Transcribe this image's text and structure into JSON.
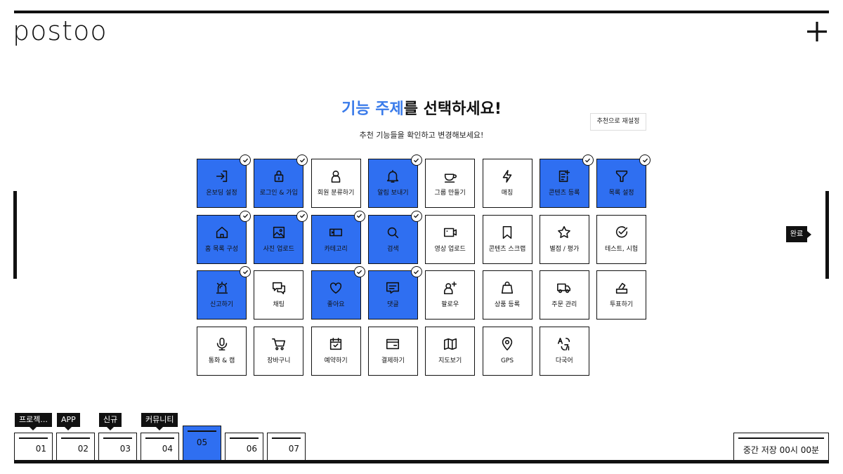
{
  "brand": {
    "logo": "postoo"
  },
  "header": {
    "plus_icon": "plus-icon"
  },
  "title": {
    "highlight": "기능 주제",
    "rest": "를 선택하세요!"
  },
  "subtitle": "추천 기능들을 확인하고 변경해보세요!",
  "reset_label": "추천으로 재설정",
  "done_label": "완료",
  "accent_color": "#2f6ff1",
  "features": [
    {
      "label": "온보딩 설정",
      "icon": "enter-icon",
      "selected": true
    },
    {
      "label": "로그인 & 가입",
      "icon": "lock-icon",
      "selected": true
    },
    {
      "label": "회원 분류하기",
      "icon": "person-icon",
      "selected": false
    },
    {
      "label": "알림 보내기",
      "icon": "bell-icon",
      "selected": true
    },
    {
      "label": "그룹 만들기",
      "icon": "cup-icon",
      "selected": false
    },
    {
      "label": "매칭",
      "icon": "lightning-icon",
      "selected": false
    },
    {
      "label": "콘텐츠 등록",
      "icon": "doc-plus-icon",
      "selected": true
    },
    {
      "label": "목록 설정",
      "icon": "filter-icon",
      "selected": true
    },
    {
      "label": "홈 목록 구성",
      "icon": "home-icon",
      "selected": true
    },
    {
      "label": "사진 업로드",
      "icon": "image-icon",
      "selected": true
    },
    {
      "label": "카테고리",
      "icon": "ticket-icon",
      "selected": true
    },
    {
      "label": "검색",
      "icon": "search-icon",
      "selected": true
    },
    {
      "label": "영상 업로드",
      "icon": "video-icon",
      "selected": false
    },
    {
      "label": "콘텐츠 스크랩",
      "icon": "bookmark-icon",
      "selected": false
    },
    {
      "label": "별점 / 평가",
      "icon": "star-icon",
      "selected": false
    },
    {
      "label": "테스트, 시험",
      "icon": "check-circle-icon",
      "selected": false
    },
    {
      "label": "신고하기",
      "icon": "siren-icon",
      "selected": true
    },
    {
      "label": "채팅",
      "icon": "chat-icon",
      "selected": false
    },
    {
      "label": "좋아요",
      "icon": "heart-icon",
      "selected": true
    },
    {
      "label": "댓글",
      "icon": "comment-icon",
      "selected": true
    },
    {
      "label": "팔로우",
      "icon": "person-plus-icon",
      "selected": false
    },
    {
      "label": "상품 등록",
      "icon": "shopping-bag-icon",
      "selected": false
    },
    {
      "label": "주문 관리",
      "icon": "truck-icon",
      "selected": false
    },
    {
      "label": "투표하기",
      "icon": "vote-icon",
      "selected": false
    },
    {
      "label": "통화 & 캠",
      "icon": "mic-icon",
      "selected": false
    },
    {
      "label": "장바구니",
      "icon": "cart-icon",
      "selected": false
    },
    {
      "label": "예약하기",
      "icon": "calendar-icon",
      "selected": false
    },
    {
      "label": "결제하기",
      "icon": "card-icon",
      "selected": false
    },
    {
      "label": "지도보기",
      "icon": "map-icon",
      "selected": false
    },
    {
      "label": "GPS",
      "icon": "pin-icon",
      "selected": false
    },
    {
      "label": "다국어",
      "icon": "translate-icon",
      "selected": false
    }
  ],
  "steps": [
    {
      "num": "01",
      "tag": "프로젝...",
      "active": false
    },
    {
      "num": "02",
      "tag": "APP",
      "active": false
    },
    {
      "num": "03",
      "tag": "신규",
      "active": false
    },
    {
      "num": "04",
      "tag": "커뮤니티",
      "active": false
    },
    {
      "num": "05",
      "tag": "",
      "active": true
    },
    {
      "num": "06",
      "tag": "",
      "active": false
    },
    {
      "num": "07",
      "tag": "",
      "active": false
    }
  ],
  "save_label": "중간 저장 00시 00분"
}
